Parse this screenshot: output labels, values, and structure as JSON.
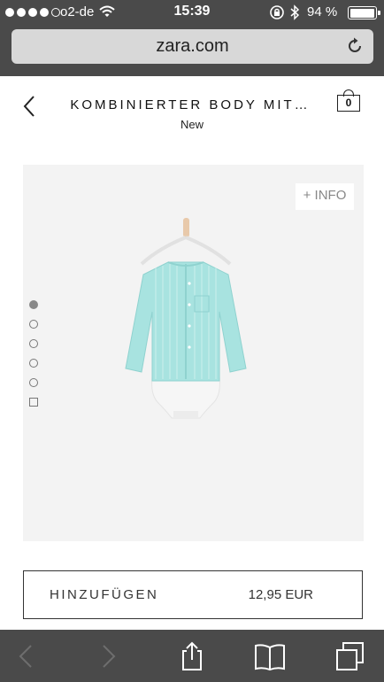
{
  "status_bar": {
    "carrier": "o2-de",
    "time": "15:39",
    "battery": "94 %",
    "signal_bars_filled": 4,
    "signal_bars_total": 5,
    "battery_level_percent": 94
  },
  "browser": {
    "url": "zara.com"
  },
  "product": {
    "title": "KOMBINIERTER BODY MIT…",
    "tag": "New",
    "cart_count": "0",
    "info_label": "+ INFO",
    "image_count": 6,
    "active_image_index": 0,
    "garment_colors": {
      "shirt": "#a8e3e0",
      "shirt_stripe": "#d7f3f1",
      "body": "#f6f6f6",
      "hanger": "#e8c9aa"
    }
  },
  "actions": {
    "add_label": "HINZUFÜGEN",
    "price": "12,95 EUR"
  },
  "icons": {
    "wifi": "wifi-icon",
    "lock": "rotation-lock-icon",
    "bluetooth": "bluetooth-icon",
    "battery": "battery-icon",
    "reload": "reload-icon",
    "back": "chevron-left-icon",
    "cart": "shopping-bag-icon",
    "toolbar": [
      "back-arrow-icon",
      "forward-arrow-icon",
      "share-icon",
      "bookmarks-icon",
      "tabs-icon"
    ]
  }
}
